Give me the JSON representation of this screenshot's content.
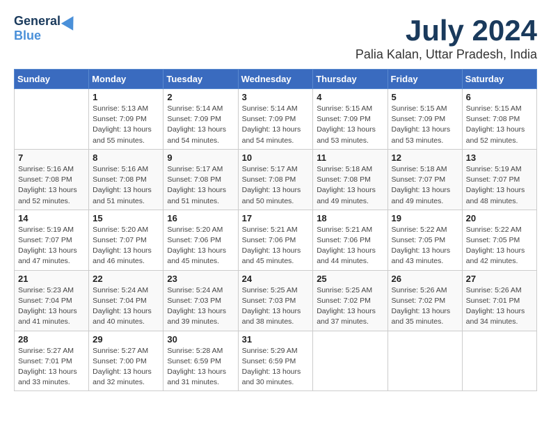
{
  "header": {
    "logo_general": "General",
    "logo_blue": "Blue",
    "month_year": "July 2024",
    "location": "Palia Kalan, Uttar Pradesh, India"
  },
  "days_of_week": [
    "Sunday",
    "Monday",
    "Tuesday",
    "Wednesday",
    "Thursday",
    "Friday",
    "Saturday"
  ],
  "weeks": [
    [
      {
        "day": "",
        "info": ""
      },
      {
        "day": "1",
        "info": "Sunrise: 5:13 AM\nSunset: 7:09 PM\nDaylight: 13 hours\nand 55 minutes."
      },
      {
        "day": "2",
        "info": "Sunrise: 5:14 AM\nSunset: 7:09 PM\nDaylight: 13 hours\nand 54 minutes."
      },
      {
        "day": "3",
        "info": "Sunrise: 5:14 AM\nSunset: 7:09 PM\nDaylight: 13 hours\nand 54 minutes."
      },
      {
        "day": "4",
        "info": "Sunrise: 5:15 AM\nSunset: 7:09 PM\nDaylight: 13 hours\nand 53 minutes."
      },
      {
        "day": "5",
        "info": "Sunrise: 5:15 AM\nSunset: 7:09 PM\nDaylight: 13 hours\nand 53 minutes."
      },
      {
        "day": "6",
        "info": "Sunrise: 5:15 AM\nSunset: 7:08 PM\nDaylight: 13 hours\nand 52 minutes."
      }
    ],
    [
      {
        "day": "7",
        "info": "Sunrise: 5:16 AM\nSunset: 7:08 PM\nDaylight: 13 hours\nand 52 minutes."
      },
      {
        "day": "8",
        "info": "Sunrise: 5:16 AM\nSunset: 7:08 PM\nDaylight: 13 hours\nand 51 minutes."
      },
      {
        "day": "9",
        "info": "Sunrise: 5:17 AM\nSunset: 7:08 PM\nDaylight: 13 hours\nand 51 minutes."
      },
      {
        "day": "10",
        "info": "Sunrise: 5:17 AM\nSunset: 7:08 PM\nDaylight: 13 hours\nand 50 minutes."
      },
      {
        "day": "11",
        "info": "Sunrise: 5:18 AM\nSunset: 7:08 PM\nDaylight: 13 hours\nand 49 minutes."
      },
      {
        "day": "12",
        "info": "Sunrise: 5:18 AM\nSunset: 7:07 PM\nDaylight: 13 hours\nand 49 minutes."
      },
      {
        "day": "13",
        "info": "Sunrise: 5:19 AM\nSunset: 7:07 PM\nDaylight: 13 hours\nand 48 minutes."
      }
    ],
    [
      {
        "day": "14",
        "info": "Sunrise: 5:19 AM\nSunset: 7:07 PM\nDaylight: 13 hours\nand 47 minutes."
      },
      {
        "day": "15",
        "info": "Sunrise: 5:20 AM\nSunset: 7:07 PM\nDaylight: 13 hours\nand 46 minutes."
      },
      {
        "day": "16",
        "info": "Sunrise: 5:20 AM\nSunset: 7:06 PM\nDaylight: 13 hours\nand 45 minutes."
      },
      {
        "day": "17",
        "info": "Sunrise: 5:21 AM\nSunset: 7:06 PM\nDaylight: 13 hours\nand 45 minutes."
      },
      {
        "day": "18",
        "info": "Sunrise: 5:21 AM\nSunset: 7:06 PM\nDaylight: 13 hours\nand 44 minutes."
      },
      {
        "day": "19",
        "info": "Sunrise: 5:22 AM\nSunset: 7:05 PM\nDaylight: 13 hours\nand 43 minutes."
      },
      {
        "day": "20",
        "info": "Sunrise: 5:22 AM\nSunset: 7:05 PM\nDaylight: 13 hours\nand 42 minutes."
      }
    ],
    [
      {
        "day": "21",
        "info": "Sunrise: 5:23 AM\nSunset: 7:04 PM\nDaylight: 13 hours\nand 41 minutes."
      },
      {
        "day": "22",
        "info": "Sunrise: 5:24 AM\nSunset: 7:04 PM\nDaylight: 13 hours\nand 40 minutes."
      },
      {
        "day": "23",
        "info": "Sunrise: 5:24 AM\nSunset: 7:03 PM\nDaylight: 13 hours\nand 39 minutes."
      },
      {
        "day": "24",
        "info": "Sunrise: 5:25 AM\nSunset: 7:03 PM\nDaylight: 13 hours\nand 38 minutes."
      },
      {
        "day": "25",
        "info": "Sunrise: 5:25 AM\nSunset: 7:02 PM\nDaylight: 13 hours\nand 37 minutes."
      },
      {
        "day": "26",
        "info": "Sunrise: 5:26 AM\nSunset: 7:02 PM\nDaylight: 13 hours\nand 35 minutes."
      },
      {
        "day": "27",
        "info": "Sunrise: 5:26 AM\nSunset: 7:01 PM\nDaylight: 13 hours\nand 34 minutes."
      }
    ],
    [
      {
        "day": "28",
        "info": "Sunrise: 5:27 AM\nSunset: 7:01 PM\nDaylight: 13 hours\nand 33 minutes."
      },
      {
        "day": "29",
        "info": "Sunrise: 5:27 AM\nSunset: 7:00 PM\nDaylight: 13 hours\nand 32 minutes."
      },
      {
        "day": "30",
        "info": "Sunrise: 5:28 AM\nSunset: 6:59 PM\nDaylight: 13 hours\nand 31 minutes."
      },
      {
        "day": "31",
        "info": "Sunrise: 5:29 AM\nSunset: 6:59 PM\nDaylight: 13 hours\nand 30 minutes."
      },
      {
        "day": "",
        "info": ""
      },
      {
        "day": "",
        "info": ""
      },
      {
        "day": "",
        "info": ""
      }
    ]
  ]
}
